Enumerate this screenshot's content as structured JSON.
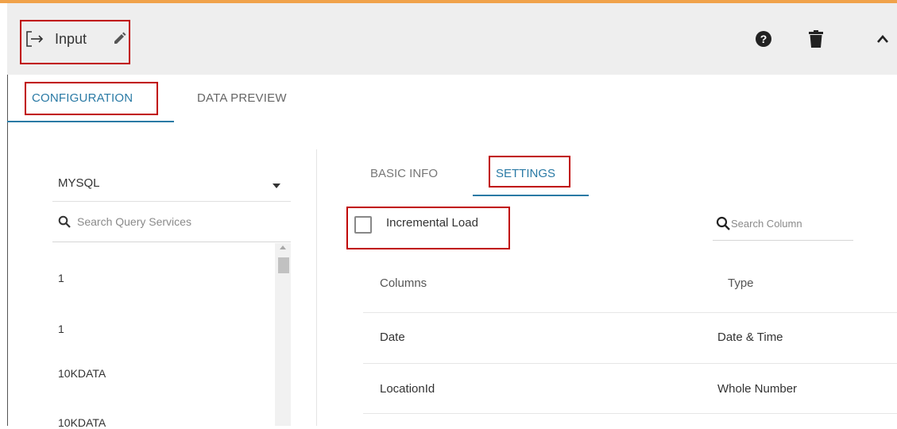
{
  "header": {
    "title": "Input",
    "icons": {
      "input": "input-arrow-icon",
      "edit": "pencil-icon",
      "help": "question-circle-icon",
      "delete": "trash-icon",
      "collapse": "chevron-up-icon"
    }
  },
  "tabs": [
    {
      "label": "CONFIGURATION",
      "active": true
    },
    {
      "label": "DATA PREVIEW",
      "active": false
    }
  ],
  "left_panel": {
    "connector": "MYSQL",
    "search": {
      "placeholder": "Search Query Services",
      "value": ""
    },
    "items": [
      "1",
      "1",
      "10KDATA",
      "10KDATA"
    ]
  },
  "right_panel": {
    "subtabs": [
      {
        "label": "BASIC INFO",
        "active": false
      },
      {
        "label": "SETTINGS",
        "active": true
      }
    ],
    "incremental_load": {
      "label": "Incremental Load",
      "checked": false
    },
    "column_search": {
      "placeholder": "Search Column",
      "value": ""
    },
    "table": {
      "headers": [
        "Columns",
        "Type"
      ],
      "rows": [
        [
          "Date",
          "Date & Time"
        ],
        [
          "LocationId",
          "Whole Number"
        ]
      ]
    }
  },
  "colors": {
    "accent": "#2a7aa5",
    "highlight": "#c00000",
    "top_border": "#f0a24a"
  }
}
